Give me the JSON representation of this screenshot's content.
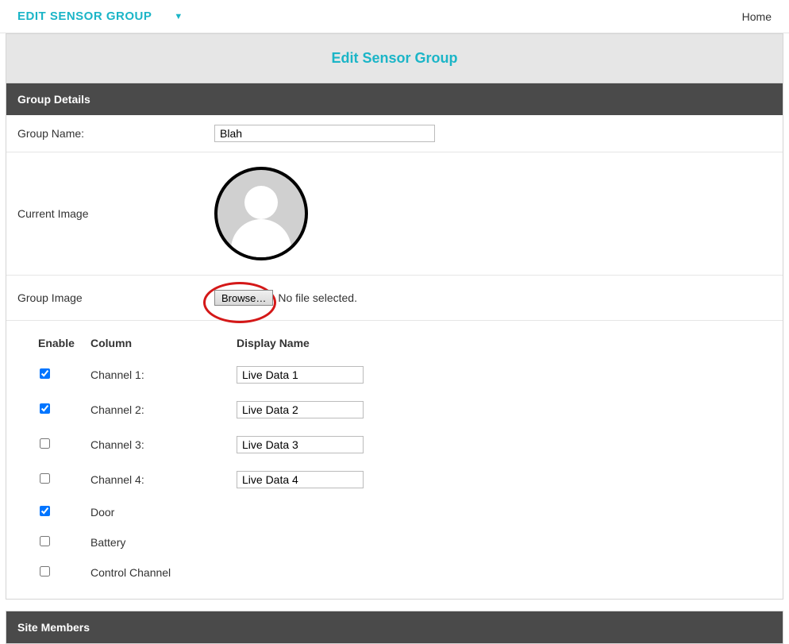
{
  "topbar": {
    "title": "EDIT SENSOR GROUP",
    "home": "Home"
  },
  "page_title": "Edit Sensor Group",
  "panels": {
    "group_details": "Group Details",
    "site_members": "Site Members"
  },
  "form": {
    "group_name_label": "Group Name:",
    "group_name_value": "Blah",
    "current_image_label": "Current Image",
    "group_image_label": "Group Image",
    "browse_label": "Browse…",
    "file_status": "No file selected."
  },
  "channels_header": {
    "enable": "Enable",
    "column": "Column",
    "display": "Display Name"
  },
  "channels": [
    {
      "enabled": true,
      "label": "Channel 1:",
      "display": "Live Data 1",
      "has_input": true
    },
    {
      "enabled": true,
      "label": "Channel 2:",
      "display": "Live Data 2",
      "has_input": true
    },
    {
      "enabled": false,
      "label": "Channel 3:",
      "display": "Live Data 3",
      "has_input": true
    },
    {
      "enabled": false,
      "label": "Channel 4:",
      "display": "Live Data 4",
      "has_input": true
    },
    {
      "enabled": true,
      "label": "Door",
      "display": "",
      "has_input": false
    },
    {
      "enabled": false,
      "label": "Battery",
      "display": "",
      "has_input": false
    },
    {
      "enabled": false,
      "label": "Control Channel",
      "display": "",
      "has_input": false
    }
  ]
}
